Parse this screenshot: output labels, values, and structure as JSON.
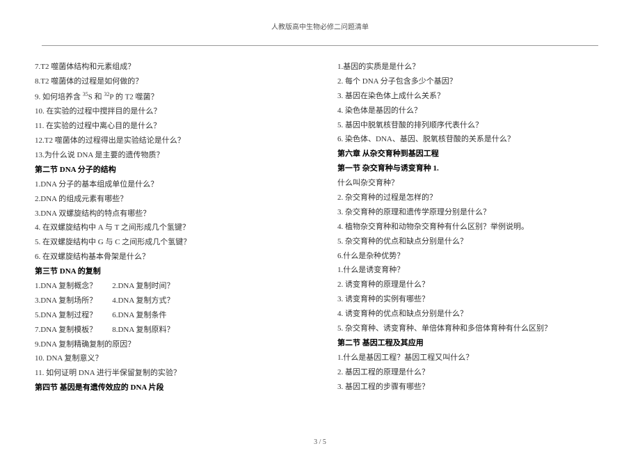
{
  "header": "人教版高中生物必修二问题清单",
  "footer": "3 / 5",
  "left_column": [
    {
      "type": "line",
      "text": "7.T2 噬菌体结构和元素组成？"
    },
    {
      "type": "line",
      "text": "8.T2 噬菌体的过程是如何做的？"
    },
    {
      "type": "line_html",
      "text": "9. 如何培养含 <sup>35</sup>S 和 <sup>32</sup>P 的 T2 噬菌？"
    },
    {
      "type": "line",
      "text": "10. 在实验的过程中搅拌目的是什么？"
    },
    {
      "type": "line",
      "text": "11. 在实验的过程中离心目的是什么？"
    },
    {
      "type": "line",
      "text": "12.T2 噬菌体的过程得出是实验结论是什么？"
    },
    {
      "type": "line",
      "text": "13.为什么说 DNA 是主要的遗传物质？"
    },
    {
      "type": "section",
      "text": "第二节 DNA 分子的结构"
    },
    {
      "type": "line",
      "text": "1.DNA 分子的基本组成单位是什么？"
    },
    {
      "type": "line",
      "text": "2.DNA 的组成元素有哪些？"
    },
    {
      "type": "line",
      "text": "3.DNA 双螺旋结构的特点有哪些？"
    },
    {
      "type": "line",
      "text": "4. 在双螺旋结构中 A 与 T 之间形成几个氢键？"
    },
    {
      "type": "line",
      "text": "5. 在双螺旋结构中 G 与 C 之间形成几个氢键？"
    },
    {
      "type": "line",
      "text": "6. 在双螺旋结构基本骨架是什么？"
    },
    {
      "type": "section",
      "text": "第三节 DNA 的复制"
    },
    {
      "type": "line",
      "text": "1.DNA 复制概念？　　2.DNA 复制时间？"
    },
    {
      "type": "line",
      "text": "3.DNA 复制场所？　　4.DNA 复制方式？"
    },
    {
      "type": "line",
      "text": "5.DNA 复制过程？　　6.DNA 复制条件"
    },
    {
      "type": "line",
      "text": "7.DNA 复制模板？　　8.DNA 复制原料？"
    },
    {
      "type": "line",
      "text": "9.DNA 复制精确复制的原因？"
    },
    {
      "type": "line",
      "text": "10. DNA 复制意义？"
    },
    {
      "type": "line",
      "text": "11. 如何证明 DNA 进行半保留复制的实验？"
    },
    {
      "type": "section",
      "text": "第四节 基因是有遗传效应的 DNA 片段"
    }
  ],
  "right_column": [
    {
      "type": "line",
      "text": "1.基因的实质是是什么？"
    },
    {
      "type": "line",
      "text": "2. 每个 DNA 分子包含多少个基因？"
    },
    {
      "type": "line",
      "text": "3. 基因在染色体上成什么关系？"
    },
    {
      "type": "line",
      "text": "4. 染色体是基因的什么？"
    },
    {
      "type": "line",
      "text": "5. 基因中脱氧核苷酸的排列顺序代表什么？"
    },
    {
      "type": "line",
      "text": "6. 染色体、DNA、基因、脱氧核苷酸的关系是什么？"
    },
    {
      "type": "section",
      "text": "第六章 从杂交育种到基因工程"
    },
    {
      "type": "section",
      "text": "第一节  杂交育种与诱变育种 1."
    },
    {
      "type": "line",
      "text": "什么叫杂交育种？"
    },
    {
      "type": "line",
      "text": "2. 杂交育种的过程是怎样的？"
    },
    {
      "type": "line",
      "text": "3. 杂交育种的原理和遗传学原理分别是什么？"
    },
    {
      "type": "line",
      "text": "4. 植物杂交育种和动物杂交育种有什么区别？举例说明。"
    },
    {
      "type": "line",
      "text": "5. 杂交育种的优点和缺点分别是什么？"
    },
    {
      "type": "line",
      "text": "6.什么是杂种优势？"
    },
    {
      "type": "line",
      "text": "1.什么是诱变育种？"
    },
    {
      "type": "line",
      "text": "2. 诱变育种的原理是什么？"
    },
    {
      "type": "line",
      "text": "3. 诱变育种的实例有哪些？"
    },
    {
      "type": "line",
      "text": "4. 诱变育种的优点和缺点分别是什么？"
    },
    {
      "type": "line",
      "text": "5. 杂交育种、诱变育种、单倍体育种和多倍体育种有什么区别？"
    },
    {
      "type": "section",
      "text": "第二节 基因工程及其应用"
    },
    {
      "type": "line",
      "text": "1.什么是基因工程？基因工程又叫什么？"
    },
    {
      "type": "line",
      "text": "2. 基因工程的原理是什么？"
    },
    {
      "type": "line",
      "text": "3. 基因工程的步骤有哪些？"
    }
  ]
}
